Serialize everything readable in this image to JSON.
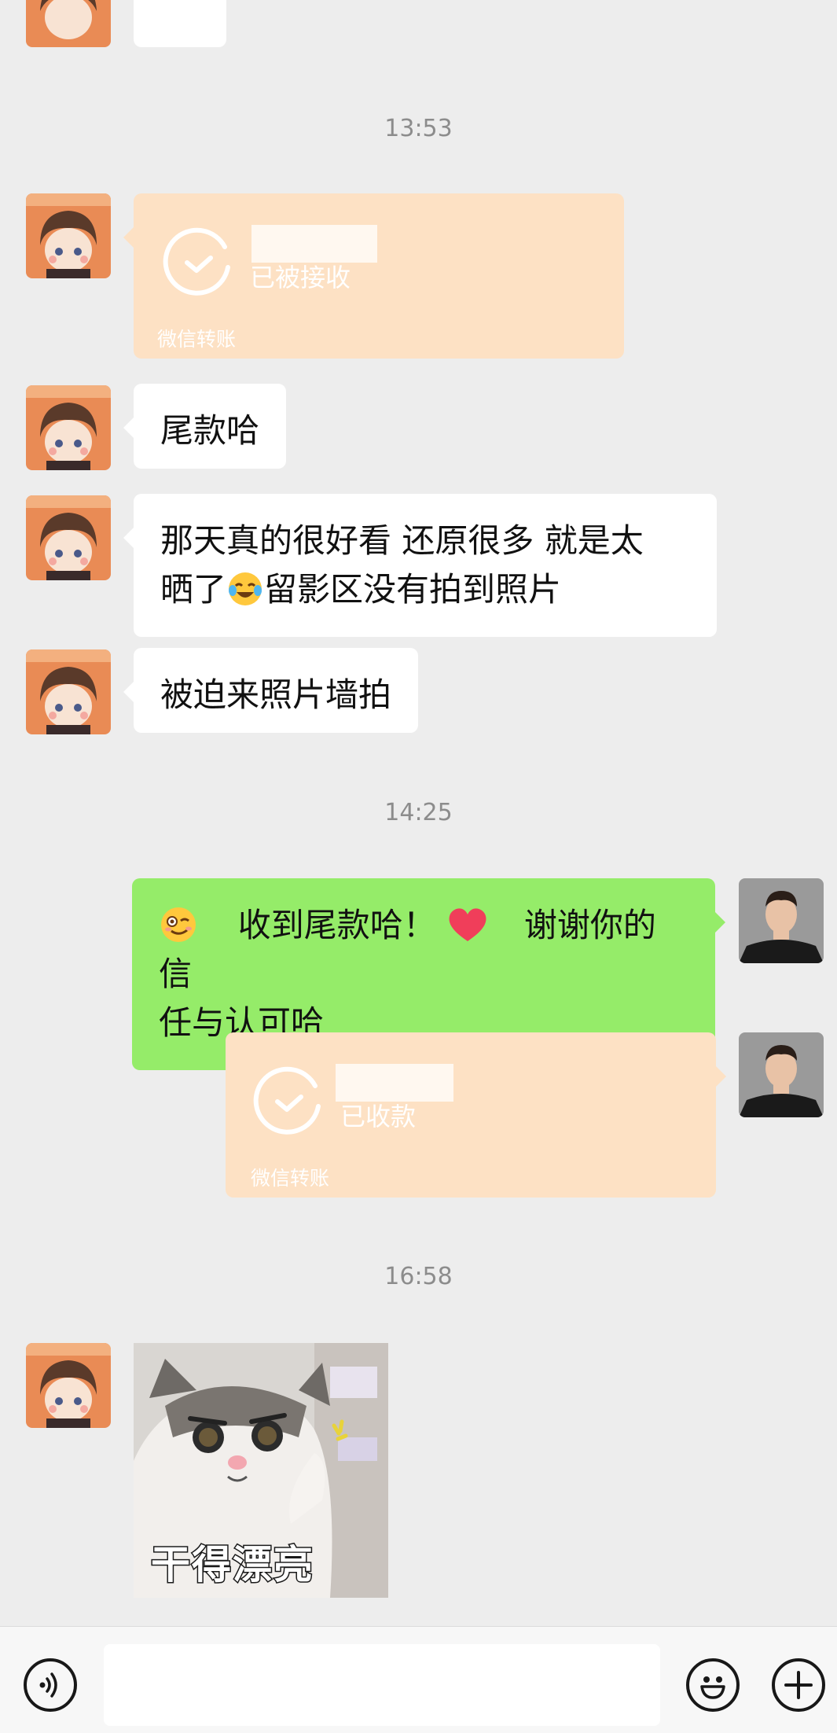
{
  "timestamps": [
    "13:53",
    "14:25",
    "16:58"
  ],
  "messages": {
    "m1": "尾款哈",
    "m2_line1": "那天真的很好看 还原很多 就是太",
    "m2_line2a": "晒了",
    "m2_line2b": "留影区没有拍到照片",
    "m3": "被迫来照片墙拍",
    "m4_part1": "收到尾款哈！",
    "m4_part2": "谢谢你的信",
    "m4_line2": "任与认可哈"
  },
  "transfers": {
    "received": {
      "status": "已被接收",
      "label": "微信转账"
    },
    "collected": {
      "status": "已收款",
      "label": "微信转账"
    }
  },
  "sticker": {
    "caption": "干得漂亮"
  },
  "input": {
    "placeholder": ""
  },
  "colors": {
    "background": "#ededed",
    "bubble_white": "#ffffff",
    "bubble_green": "#95ec69",
    "transfer": "#fde1c4",
    "timestamp": "#8c8c8c"
  }
}
